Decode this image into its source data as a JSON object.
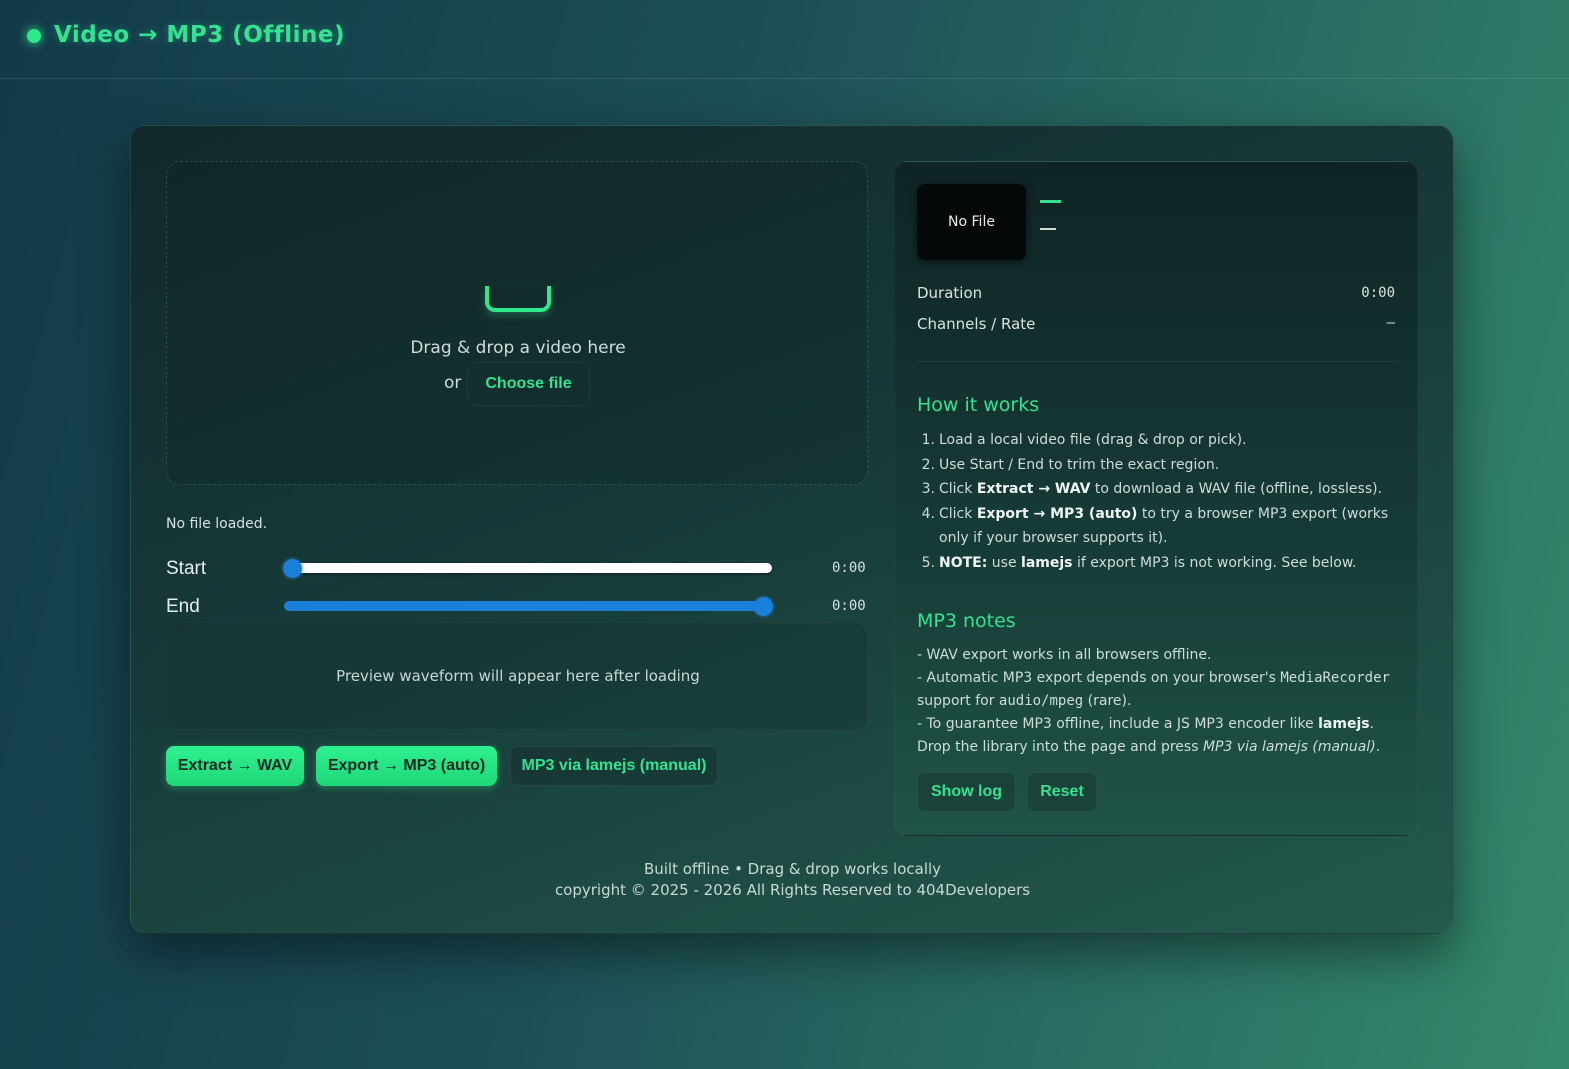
{
  "app": {
    "title": "Video → MP3 (Offline)",
    "accent_color": "#2ee889"
  },
  "dropzone": {
    "icon": "tray-icon",
    "prompt": "Drag & drop a video here",
    "or_label": "or",
    "choose_label": "Choose file"
  },
  "status": "No file loaded.",
  "trim": {
    "start_label": "Start",
    "start_value": "0:00",
    "end_label": "End",
    "end_value": "0:00"
  },
  "waveform": {
    "placeholder": "Preview waveform will appear here after loading"
  },
  "actions": {
    "extract_wav": "Extract → WAV",
    "export_mp3": "Export → MP3 (auto)",
    "lamejs": "MP3 via lamejs (manual)"
  },
  "info": {
    "thumbnail_label": "No File",
    "duration_label": "Duration",
    "duration_value": "0:00",
    "channels_label": "Channels / Rate",
    "channels_value": "–"
  },
  "how_it_works": {
    "title": "How it works",
    "steps": [
      {
        "num": "1.",
        "a": "Load a local video file (drag & drop or pick)."
      },
      {
        "num": "2.",
        "a": "Use Start / End to trim the exact region."
      },
      {
        "num": "3.",
        "a": "Click ",
        "b": "Extract → WAV",
        "c": " to download a WAV file (offline, lossless)."
      },
      {
        "num": "4.",
        "a": "Click ",
        "b": "Export → MP3 (auto)",
        "c": " to try a browser MP3 export (works only if your browser supports it)."
      },
      {
        "num": "5.",
        "b0": "NOTE:",
        "a": " use ",
        "b": "lamejs",
        "c": " if export MP3 is not working. See below."
      }
    ]
  },
  "mp3_notes": {
    "title": "MP3 notes",
    "line1": "- WAV export works in all browsers offline.",
    "line2a": "- Automatic MP3 export depends on your browser's ",
    "line2_code1": "MediaRecorder",
    "line2b": " support for ",
    "line2_code2": "audio/mpeg",
    "line2c": " (rare).",
    "line3a": "- To guarantee MP3 offline, include a JS MP3 encoder like ",
    "line3_bold": "lamejs",
    "line3b": ".",
    "line4a": "Drop the library into the page and press ",
    "line4_em": "MP3 via lamejs (manual)",
    "line4b": ".",
    "show_log": "Show log",
    "reset": "Reset"
  },
  "footer": {
    "line1": "Built offline • Drag & drop works locally",
    "line2": "copyright © 2025 - 2026 All Rights Reserved to 404Developers"
  }
}
